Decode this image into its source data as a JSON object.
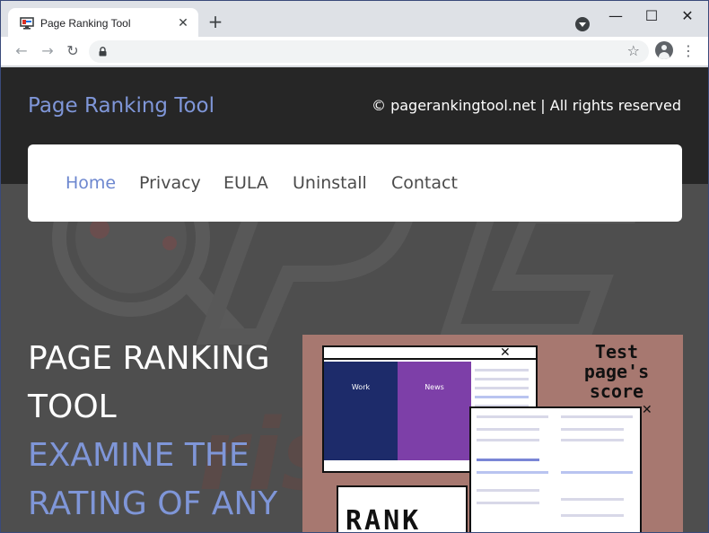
{
  "browser": {
    "tab_title": "Page Ranking Tool",
    "tab_close": "✕",
    "new_tab": "+",
    "win_min": "—",
    "win_max": "☐",
    "win_close": "✕",
    "nav_back": "←",
    "nav_forward": "→",
    "nav_reload": "↻",
    "star": "☆",
    "menu": "⋮"
  },
  "site": {
    "brand": "Page Ranking Tool",
    "copyright": "© pagerankingtool.net | All rights reserved",
    "nav": [
      "Home",
      "Privacy",
      "EULA",
      "Uninstall",
      "Contact"
    ],
    "hero": {
      "line1": "PAGE RANKING",
      "line2": "TOOL",
      "line3": "EXAMINE THE",
      "line4": "RATING OF ANY"
    },
    "promo": {
      "test_label": "Test\npage's\nscore",
      "rank_label": "RANK",
      "tile_work": "Work",
      "tile_news": "News"
    }
  },
  "colors": {
    "accent_blue": "#7f96d8",
    "header_bg": "#262626",
    "page_bg": "#4e4e4e",
    "promo_bg": "#a77870"
  },
  "icons": {
    "favicon": "monitor-icon",
    "lock": "lock-icon",
    "star": "bookmark-star-icon",
    "avatar": "profile-avatar-icon",
    "menu": "kebab-menu-icon",
    "media": "media-control-icon"
  }
}
